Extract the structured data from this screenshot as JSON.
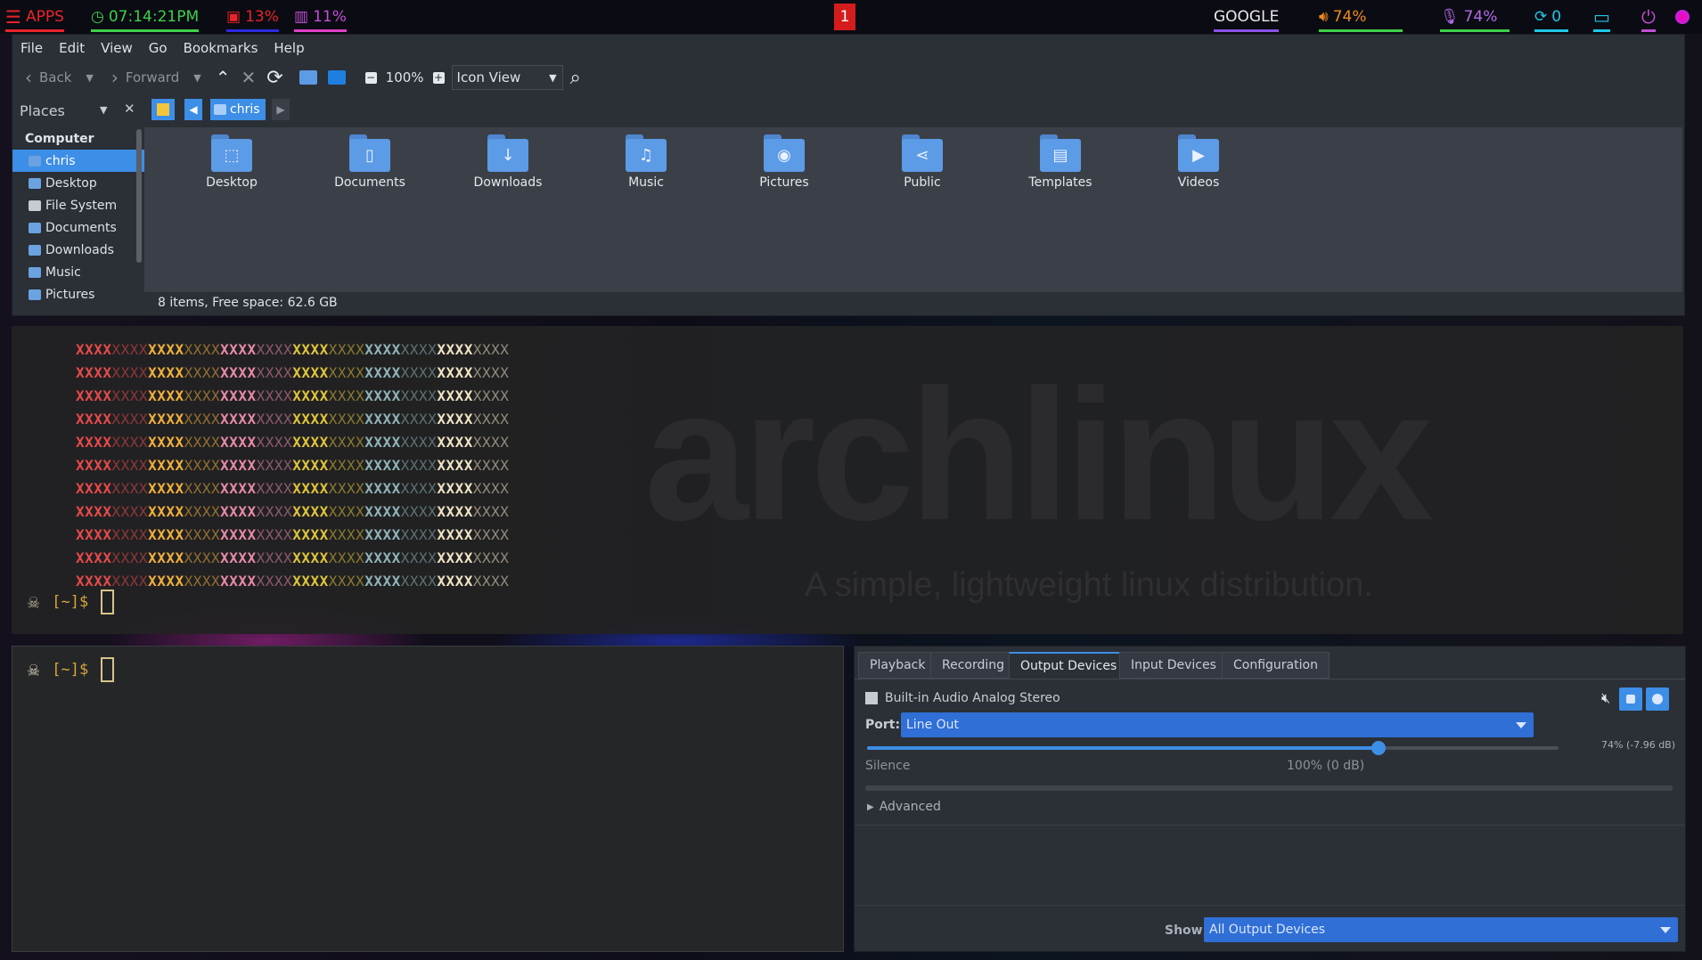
{
  "topbar": {
    "apps": "APPS",
    "clock": "07:14:21PM",
    "cpu": "13%",
    "mem": "11%",
    "workspace": "1",
    "google": "GOOGLE",
    "volume": "74%",
    "mic": "74%",
    "updates": "0",
    "colors": {
      "apps": "#e8242a",
      "clock": "#3ed04a",
      "cpu": "#e8242a",
      "mem": "#c24fd6",
      "workspace_bg": "#d51c1c",
      "google": "#8a52e6",
      "volume": "#f08a1f",
      "mic": "#b06be6",
      "updates": "#1fc9e6",
      "display": "#1fc9e6",
      "power": "#c24fd6"
    }
  },
  "filemanager": {
    "menu": [
      "File",
      "Edit",
      "View",
      "Go",
      "Bookmarks",
      "Help"
    ],
    "toolbar": {
      "back": "Back",
      "forward": "Forward",
      "zoom": "100%",
      "view": "Icon View"
    },
    "places_label": "Places",
    "path_button": "chris",
    "sidebar_heading": "Computer",
    "sidebar_items": [
      {
        "label": "chris",
        "selected": true
      },
      {
        "label": "Desktop",
        "selected": false
      },
      {
        "label": "File System",
        "selected": false
      },
      {
        "label": "Documents",
        "selected": false
      },
      {
        "label": "Downloads",
        "selected": false
      },
      {
        "label": "Music",
        "selected": false
      },
      {
        "label": "Pictures",
        "selected": false
      }
    ],
    "folders": [
      {
        "label": "Desktop",
        "icon": "desktop-icon",
        "glyph": "⬚"
      },
      {
        "label": "Documents",
        "icon": "document-icon",
        "glyph": "▯"
      },
      {
        "label": "Downloads",
        "icon": "download-icon",
        "glyph": "↓"
      },
      {
        "label": "Music",
        "icon": "music-icon",
        "glyph": "♫"
      },
      {
        "label": "Pictures",
        "icon": "camera-icon",
        "glyph": "◉"
      },
      {
        "label": "Public",
        "icon": "share-icon",
        "glyph": "⋖"
      },
      {
        "label": "Templates",
        "icon": "template-icon",
        "glyph": "▤"
      },
      {
        "label": "Videos",
        "icon": "video-icon",
        "glyph": "▶"
      }
    ],
    "status": "8 items, Free space: 62.6 GB"
  },
  "terminal1": {
    "logo_text": "archlinux",
    "logo_tagline": "A simple, lightweight linux distribution.",
    "rows": 11,
    "pattern_colors": [
      "#e84a4a",
      "#f2b13a",
      "#e88aa8",
      "#e0c43a",
      "#8fb3b8",
      "#efe3c4"
    ],
    "prompt": "[~]$"
  },
  "terminal2": {
    "prompt": "[~]$"
  },
  "pavucontrol": {
    "tabs": [
      {
        "label": "Playback",
        "active": false
      },
      {
        "label": "Recording",
        "active": false
      },
      {
        "label": "Output Devices",
        "active": true
      },
      {
        "label": "Input Devices",
        "active": false
      },
      {
        "label": "Configuration",
        "active": false
      }
    ],
    "device": "Built-in Audio Analog Stereo",
    "port_label": "Port:",
    "port_value": "Line Out",
    "volume_readout": "74% (-7.96 dB)",
    "volume_fraction": 0.74,
    "silence": "Silence",
    "full": "100% (0 dB)",
    "advanced": "Advanced",
    "show_label": "Show:",
    "show_value": "All Output Devices"
  }
}
